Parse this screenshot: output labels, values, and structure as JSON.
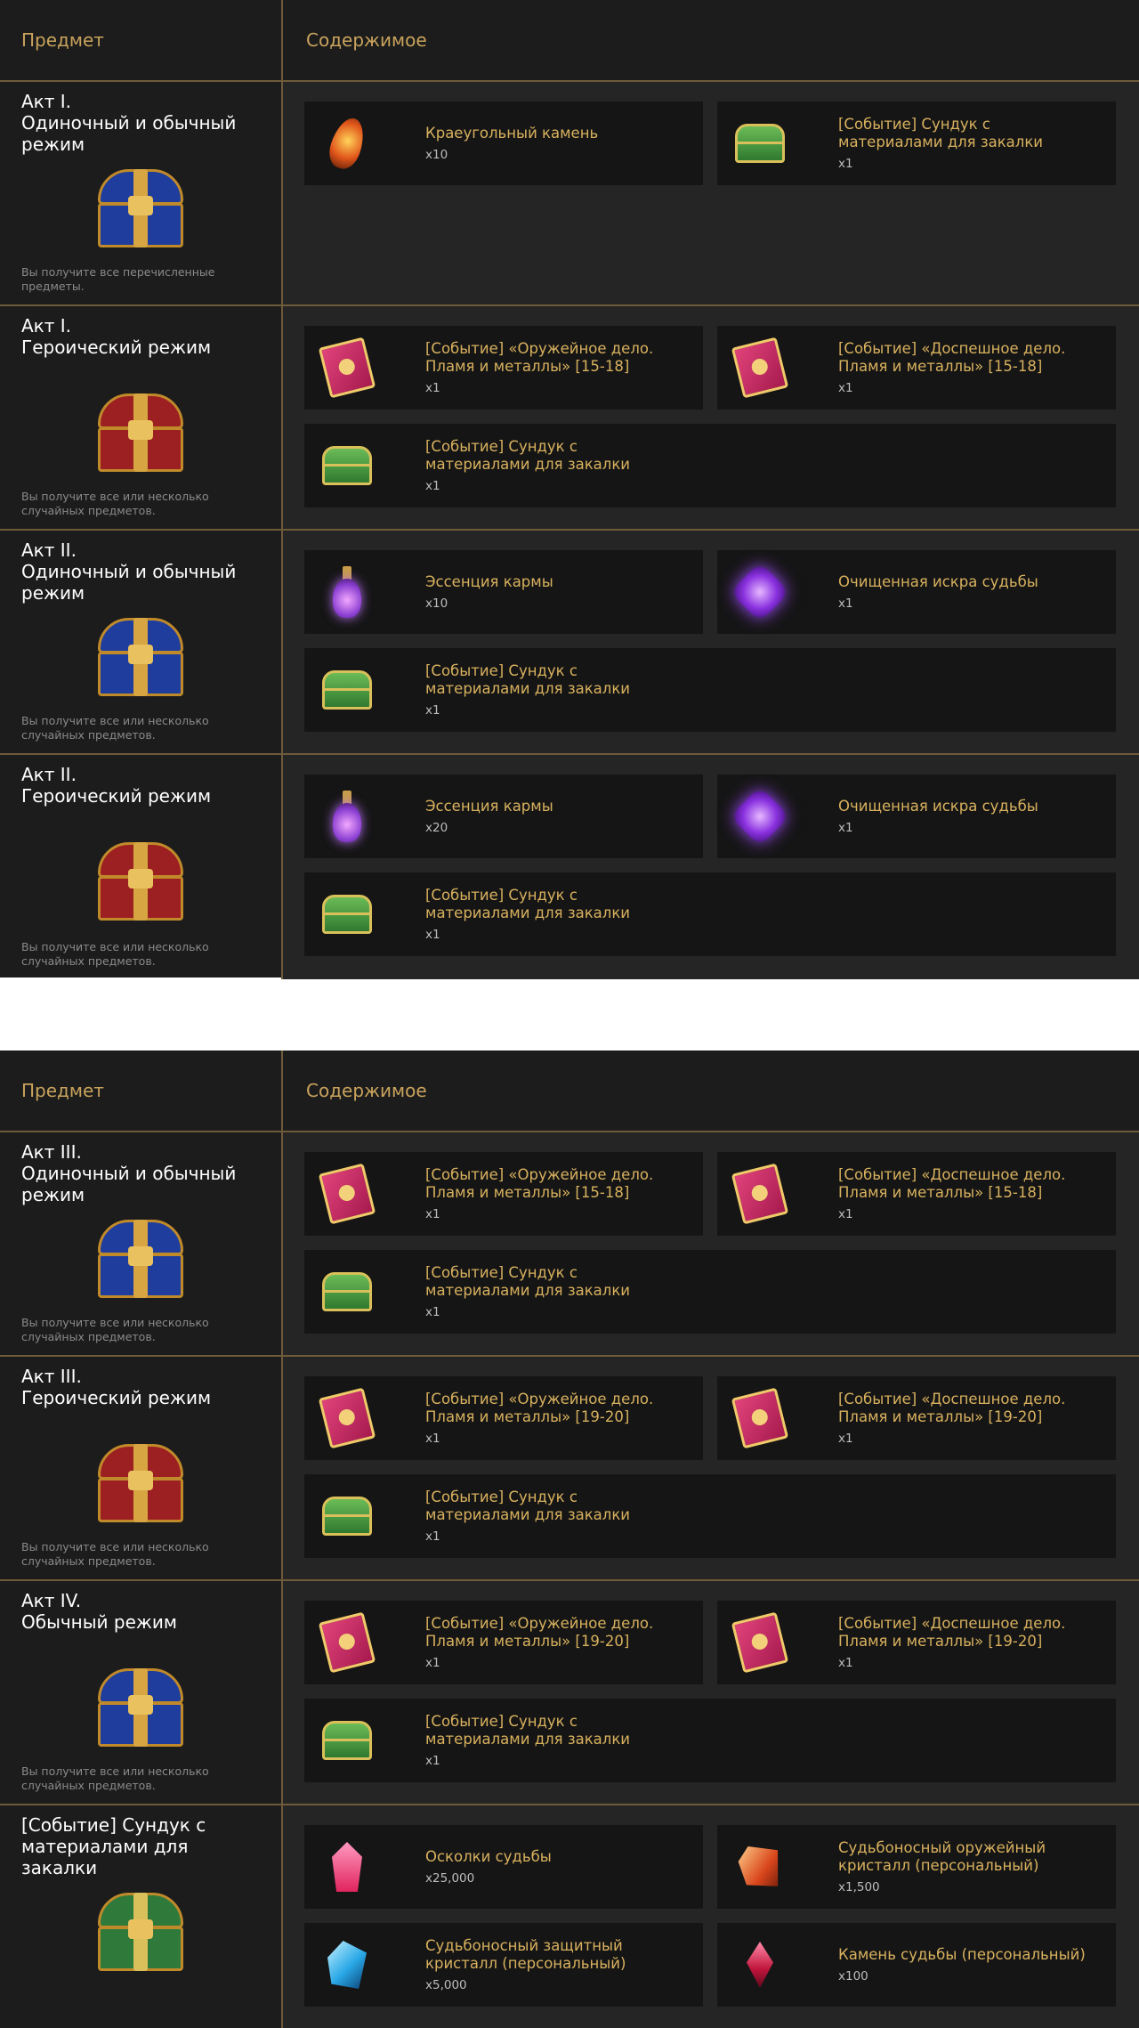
{
  "tables": [
    {
      "header": {
        "item": "Предмет",
        "contents": "Содержимое"
      },
      "rows": [
        {
          "title": "Акт I.\nОдиночный и обычный\nрежим",
          "chest_color": "blue",
          "note": "Вы получите все перечисленные предметы.",
          "items": [
            {
              "name": "Краеугольный камень",
              "qty": "x10",
              "icon": "cornerstone-icon"
            },
            {
              "name": "[Событие] Сундук с\nматериалами для закалки",
              "qty": "x1",
              "icon": "green-chest-icon"
            }
          ]
        },
        {
          "title": "Акт I.\nГероический режим",
          "chest_color": "red",
          "note": "Вы получите все или несколько случайных предметов.",
          "items": [
            {
              "name": "[Событие] «Оружейное дело.\nПламя и металлы» [15-18]",
              "qty": "x1",
              "icon": "book-icon"
            },
            {
              "name": "[Событие] «Доспешное дело.\nПламя и металлы» [15-18]",
              "qty": "x1",
              "icon": "book-icon"
            },
            {
              "name": "[Событие] Сундук с\nматериалами для закалки",
              "qty": "x1",
              "icon": "green-chest-icon"
            }
          ]
        },
        {
          "title": "Акт II.\nОдиночный и обычный\nрежим",
          "chest_color": "blue",
          "note": "Вы получите все или несколько случайных предметов.",
          "items": [
            {
              "name": "Эссенция кармы",
              "qty": "x10",
              "icon": "potion-icon"
            },
            {
              "name": "Очищенная искра судьбы",
              "qty": "x1",
              "icon": "spark-icon"
            },
            {
              "name": "[Событие] Сундук с\nматериалами для закалки",
              "qty": "x1",
              "icon": "green-chest-icon"
            }
          ]
        },
        {
          "title": "Акт II.\nГероический режим",
          "chest_color": "red",
          "note": "Вы получите все или несколько случайных предметов.",
          "items": [
            {
              "name": "Эссенция кармы",
              "qty": "x20",
              "icon": "potion-icon"
            },
            {
              "name": "Очищенная искра судьбы",
              "qty": "x1",
              "icon": "spark-icon"
            },
            {
              "name": "[Событие] Сундук с\nматериалами для закалки",
              "qty": "x1",
              "icon": "green-chest-icon"
            }
          ]
        }
      ]
    },
    {
      "header": {
        "item": "Предмет",
        "contents": "Содержимое"
      },
      "rows": [
        {
          "title": "Акт III.\nОдиночный и обычный\nрежим",
          "chest_color": "blue",
          "note": "Вы получите все или несколько случайных предметов.",
          "items": [
            {
              "name": "[Событие] «Оружейное дело.\nПламя и металлы» [15-18]",
              "qty": "x1",
              "icon": "book-icon"
            },
            {
              "name": "[Событие] «Доспешное дело.\nПламя и металлы» [15-18]",
              "qty": "x1",
              "icon": "book-icon"
            },
            {
              "name": "[Событие] Сундук с\nматериалами для закалки",
              "qty": "x1",
              "icon": "green-chest-icon"
            }
          ]
        },
        {
          "title": "Акт III.\nГероический режим",
          "chest_color": "red",
          "note": "Вы получите все или несколько случайных предметов.",
          "items": [
            {
              "name": "[Событие] «Оружейное дело.\nПламя и металлы» [19-20]",
              "qty": "x1",
              "icon": "book-icon"
            },
            {
              "name": "[Событие] «Доспешное дело.\nПламя и металлы» [19-20]",
              "qty": "x1",
              "icon": "book-icon"
            },
            {
              "name": "[Событие] Сундук с\nматериалами для закалки",
              "qty": "x1",
              "icon": "green-chest-icon"
            }
          ]
        },
        {
          "title": "Акт IV.\nОбычный режим",
          "chest_color": "blue",
          "note": "Вы получите все или несколько случайных предметов.",
          "items": [
            {
              "name": "[Событие] «Оружейное дело.\nПламя и металлы» [19-20]",
              "qty": "x1",
              "icon": "book-icon"
            },
            {
              "name": "[Событие] «Доспешное дело.\nПламя и металлы» [19-20]",
              "qty": "x1",
              "icon": "book-icon"
            },
            {
              "name": "[Событие] Сундук с\nматериалами для закалки",
              "qty": "x1",
              "icon": "green-chest-icon"
            }
          ]
        },
        {
          "title": "[Событие] Сундук с\nматериалами для закалки",
          "chest_color": "green",
          "note": "",
          "items": [
            {
              "name": "Осколки судьбы",
              "qty": "x25,000",
              "icon": "pink-crystal-icon"
            },
            {
              "name": "Судьбоносный оружейный\nкристалл (персональный)",
              "qty": "x1,500",
              "icon": "orange-crystal-icon"
            },
            {
              "name": "Судьбоносный защитный\nкристалл (персональный)",
              "qty": "x5,000",
              "icon": "blue-crystal-icon"
            },
            {
              "name": "Камень судьбы (персональный)",
              "qty": "x100",
              "icon": "red-stone-icon"
            }
          ]
        }
      ]
    }
  ],
  "colors": {
    "background": "#1c1c1c",
    "content_background": "#252525",
    "card_background": "#151515",
    "divider": "#6e5b3a",
    "header_text": "#c9a35c",
    "item_name": "#d8b15e",
    "title_text": "#ffffff",
    "note_text": "#8a8a8a"
  }
}
